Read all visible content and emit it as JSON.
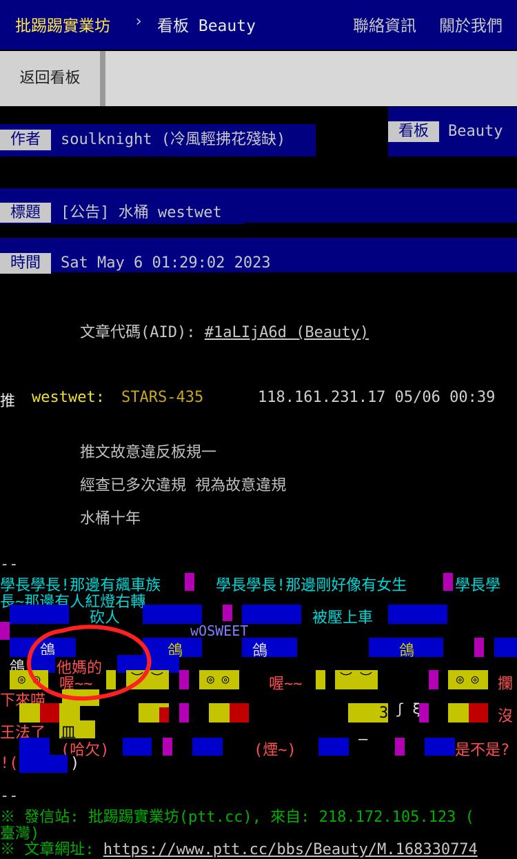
{
  "header": {
    "site_name": "批踢踢實業坊",
    "separator": "›",
    "board_label": "看板",
    "board_name": "Beauty",
    "contact": "聯絡資訊",
    "about": "關於我們"
  },
  "subnav": {
    "back": "返回看板"
  },
  "meta": {
    "author_label": "作者",
    "author_value": "soulknight (冷風輕拂花殘缺)",
    "board_label": "看板",
    "board_value": "Beauty",
    "title_label": "標題",
    "title_value": "[公告] 水桶 westwet",
    "time_label": "時間",
    "time_value": "Sat May  6 01:29:02 2023"
  },
  "aid": {
    "label": "文章代碼(AID): ",
    "link": "#1aLIjA6d (Beauty)"
  },
  "push": {
    "tag": "推",
    "user": "westwet",
    "colon": ":",
    "content": "STARS-435",
    "ipdate": "118.161.231.17 05/06 00:39"
  },
  "body": {
    "line1": "推文故意違反板規一",
    "line2": "經查已多次違規  視為故意違規",
    "line3": "水桶十年"
  },
  "signature": {
    "divider": "--",
    "l1a": "學長學長!那邊有飆車族",
    "l1b": "學長學長!那邊剛好像有女生",
    "l1c": "學長學",
    "l2": "長~那邊有人紅燈右轉",
    "kanren": "砍人",
    "beiya": "被壓上車",
    "wosweet": "wOSWEET",
    "ge": "鴿",
    "tamade": "他媽的",
    "eyes": "◎ ◎",
    "brows": "︶ ︶",
    "wo": "喔~~",
    "lan": "攔",
    "xialai": "下來喵",
    "mei": "沒",
    "wangfa": "王法了",
    "min": "皿",
    "num3": "3",
    "xi": "ʃ ξ",
    "haqian": "(哈欠)",
    "yan": "(煙~)",
    "dash": "—",
    "shibushi": "是不是?",
    "bang": "!(",
    "close": ")"
  },
  "footer": {
    "divider": "--",
    "station": "※ 發信站: 批踢踢實業坊(ptt.cc), 來自: 218.172.105.123 (",
    "station2": "臺灣)",
    "url_label": "※ 文章網址: ",
    "url": "https://www.ptt.cc/bbs/Beauty/M.168330774"
  }
}
